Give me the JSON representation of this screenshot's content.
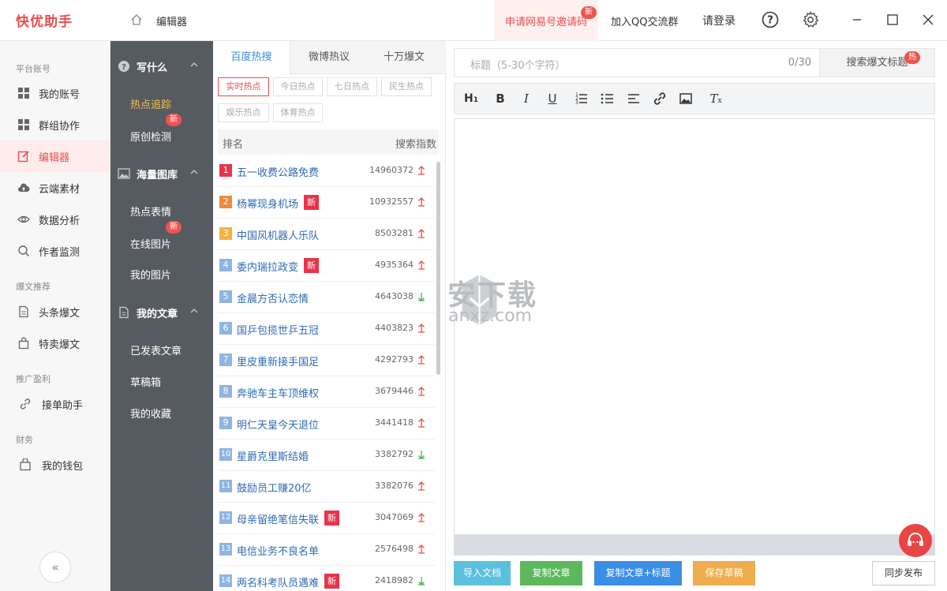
{
  "app": {
    "logo": "快优助手",
    "breadcrumb": "编辑器",
    "invite": "申请网易号邀请码",
    "invite_badge": "新",
    "qq_group": "加入QQ交流群",
    "login": "请登录"
  },
  "leftnav": {
    "sections": [
      {
        "title": "平台账号"
      },
      {
        "title": "爆文推荐"
      },
      {
        "title": "推广盈利"
      },
      {
        "title": "财务"
      }
    ],
    "items": [
      {
        "label": "我的账号",
        "icon": "grid-icon"
      },
      {
        "label": "群组协作",
        "icon": "grid-icon"
      },
      {
        "label": "编辑器",
        "icon": "edit-icon",
        "active": true
      },
      {
        "label": "云端素材",
        "icon": "cloud-icon"
      },
      {
        "label": "数据分析",
        "icon": "eye-icon"
      },
      {
        "label": "作者监测",
        "icon": "search-icon"
      },
      {
        "label": "头条爆文",
        "icon": "document-icon"
      },
      {
        "label": "特卖爆文",
        "icon": "bag-icon"
      },
      {
        "label": "接单助手",
        "icon": "link-icon"
      },
      {
        "label": "我的钱包",
        "icon": "wallet-icon"
      }
    ],
    "collapse": "«"
  },
  "subnav": {
    "groups": [
      {
        "title": "写什么",
        "items": [
          "热点追踪",
          "原创检测"
        ]
      },
      {
        "title": "海量图库",
        "items": [
          "热点表情",
          "在线图片",
          "我的图片"
        ]
      },
      {
        "title": "我的文章",
        "items": [
          "已发表文章",
          "草稿箱",
          "我的收藏"
        ]
      }
    ],
    "new_badge": "新"
  },
  "hot": {
    "tabs": [
      "百度热搜",
      "微博热议",
      "十万爆文"
    ],
    "chips": [
      "实时热点",
      "今日热点",
      "七日热点",
      "民生热点",
      "娱乐热点",
      "体育热点"
    ],
    "col_rank": "排名",
    "col_index": "搜索指数",
    "new_label": "新",
    "rows": [
      {
        "rank": "1",
        "title": "五一收费公路免费",
        "value": "14960372",
        "trend": "up",
        "new": false
      },
      {
        "rank": "2",
        "title": "杨幂现身机场",
        "value": "10932557",
        "trend": "up",
        "new": true
      },
      {
        "rank": "3",
        "title": "中国风机器人乐队",
        "value": "8503281",
        "trend": "up",
        "new": false
      },
      {
        "rank": "4",
        "title": "委内瑞拉政变",
        "value": "4935364",
        "trend": "up",
        "new": true
      },
      {
        "rank": "5",
        "title": "金晨方否认恋情",
        "value": "4643038",
        "trend": "down",
        "new": false
      },
      {
        "rank": "6",
        "title": "国乒包揽世乒五冠",
        "value": "4403823",
        "trend": "up",
        "new": false
      },
      {
        "rank": "7",
        "title": "里皮重新接手国足",
        "value": "4292793",
        "trend": "up",
        "new": false
      },
      {
        "rank": "8",
        "title": "奔驰车主车顶维权",
        "value": "3679446",
        "trend": "up",
        "new": false
      },
      {
        "rank": "9",
        "title": "明仁天皇今天退位",
        "value": "3441418",
        "trend": "up",
        "new": false
      },
      {
        "rank": "10",
        "title": "星爵克里斯结婚",
        "value": "3382792",
        "trend": "down",
        "new": false
      },
      {
        "rank": "11",
        "title": "鼓励员工赚20亿",
        "value": "3382076",
        "trend": "up",
        "new": false
      },
      {
        "rank": "12",
        "title": "母亲留绝笔信失联",
        "value": "3047069",
        "trend": "up",
        "new": true
      },
      {
        "rank": "13",
        "title": "电信业务不良名单",
        "value": "2576498",
        "trend": "up",
        "new": false
      },
      {
        "rank": "14",
        "title": "两名科考队员遇难",
        "value": "2418982",
        "trend": "down",
        "new": true
      }
    ]
  },
  "editor": {
    "title_placeholder": "标题（5-30个字符）",
    "title_count": "0/30",
    "search_title": "搜索爆文标题",
    "hot_badge": "热",
    "tools": [
      "heading-icon",
      "bold-icon",
      "italic-icon",
      "underline-icon",
      "ordered-list-icon",
      "unordered-list-icon",
      "align-icon",
      "link-icon",
      "image-icon",
      "clear-format-icon"
    ],
    "buttons": [
      {
        "label": "导入文档",
        "color": "#5bc0de"
      },
      {
        "label": "复制文章",
        "color": "#5cb85c"
      },
      {
        "label": "复制文章+标题",
        "color": "#3a8ee6"
      },
      {
        "label": "保存草稿",
        "color": "#f0ad4e"
      }
    ],
    "publish": "同步发布"
  },
  "watermark": {
    "text": "安下载",
    "sub": "anxz.com"
  },
  "colors": {
    "brand": "#e84e4e",
    "subnav": "#555b61",
    "link": "#2d6bb5",
    "up": "#e84e4e",
    "down": "#4caf50"
  }
}
